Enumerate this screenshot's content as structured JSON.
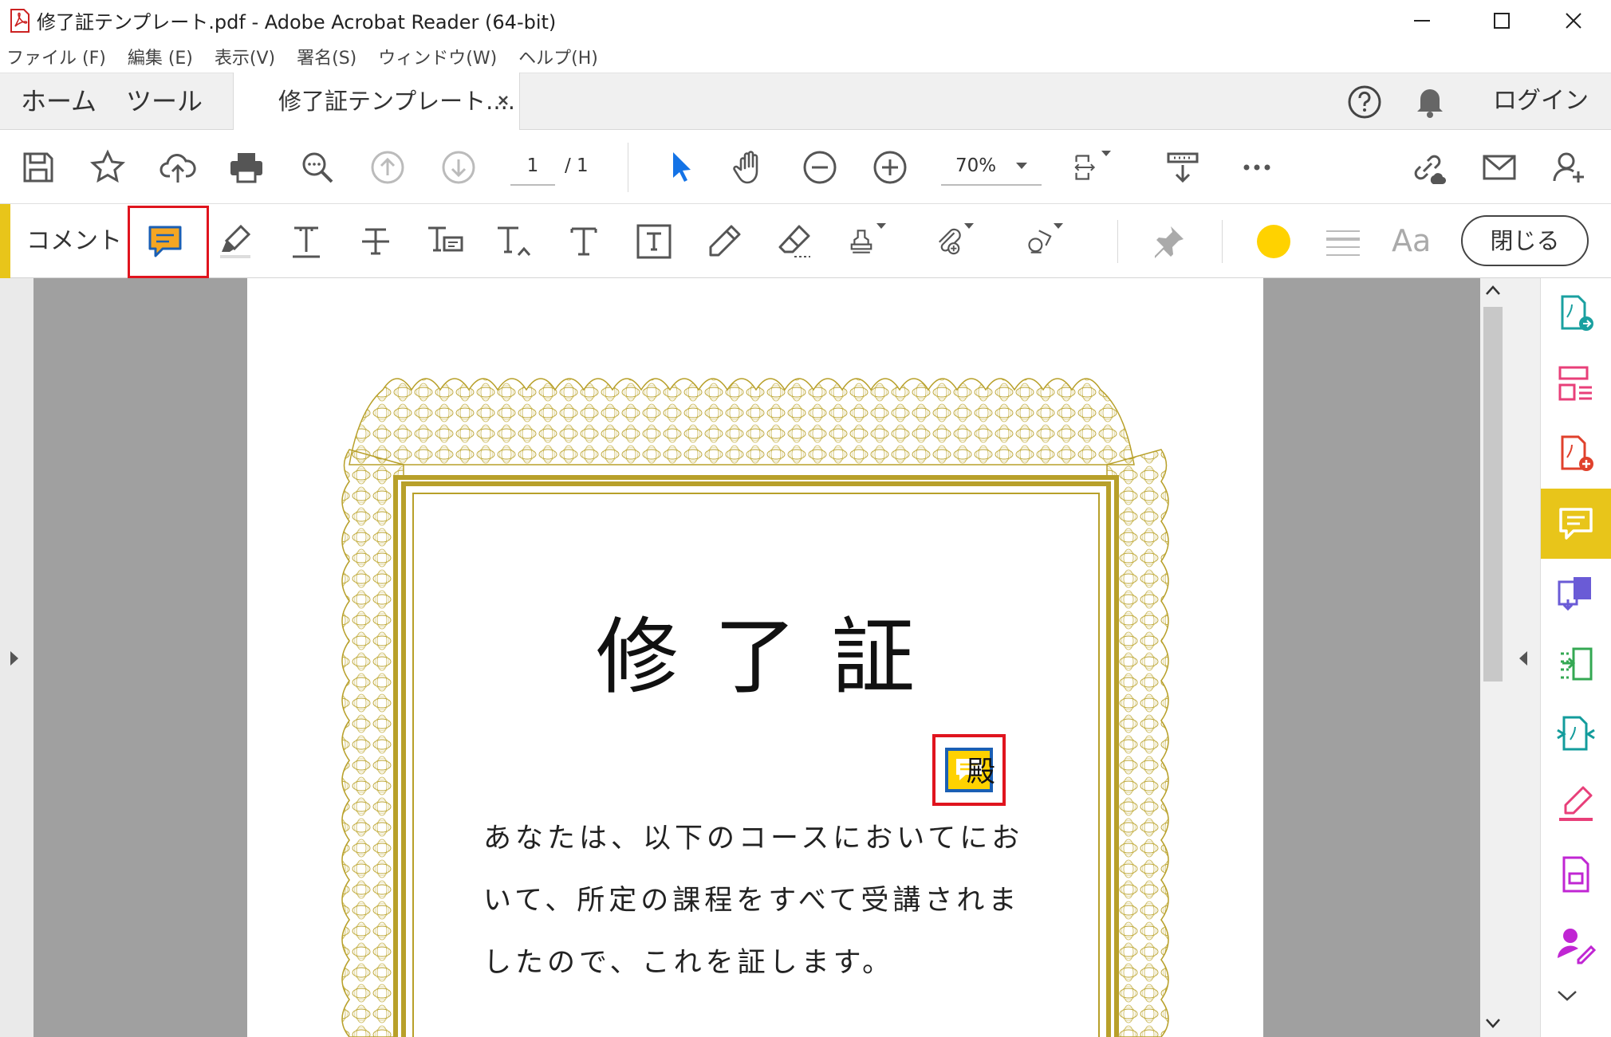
{
  "window": {
    "title": "修了証テンプレート.pdf - Adobe Acrobat Reader (64-bit)"
  },
  "menu": [
    "ファイル (F)",
    "編集 (E)",
    "表示(V)",
    "署名(S)",
    "ウィンドウ(W)",
    "ヘルプ(H)"
  ],
  "tabs": {
    "home": "ホーム",
    "tools": "ツール",
    "document": "修了証テンプレート....",
    "login": "ログイン"
  },
  "toolbar": {
    "page_current": "1",
    "page_total": "/ 1",
    "zoom": "70%"
  },
  "comment_toolbar": {
    "label": "コメント",
    "font_label": "Aa",
    "close_label": "閉じる",
    "color": "#ffd200"
  },
  "document": {
    "title": "修了証",
    "honorific": "殿",
    "body": "あなたは、以下のコースにおいてにおいて、所定の課程をすべて受講されましたので、これを証します。"
  },
  "colors": {
    "accent": "#e8c51a",
    "highlight": "#e0141e",
    "selection_blue": "#1473e6",
    "border_gold": "#b8a02a"
  }
}
